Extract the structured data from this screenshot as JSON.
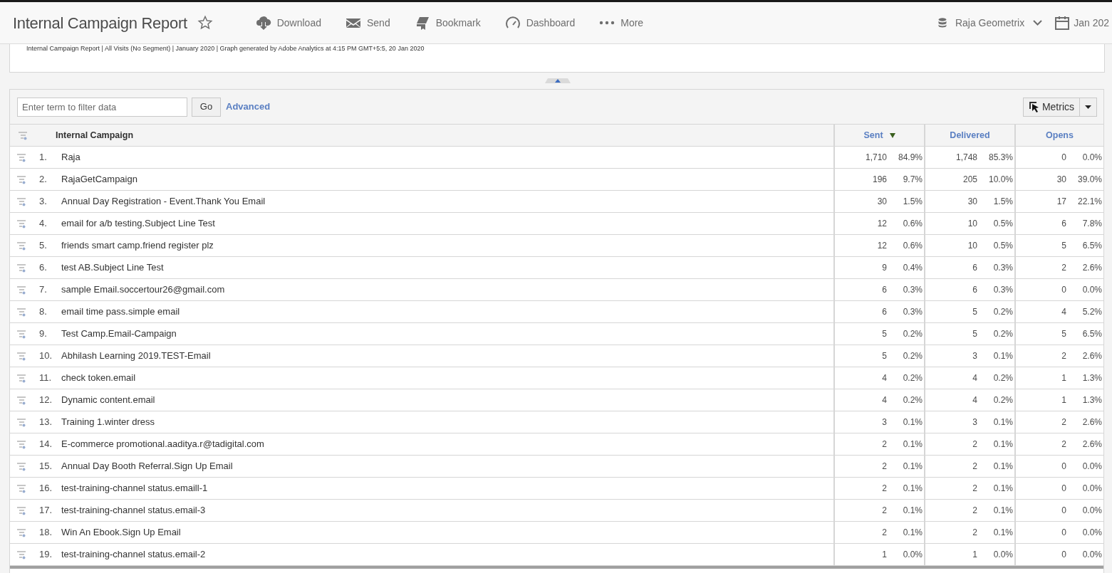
{
  "header": {
    "title": "Internal Campaign Report",
    "actions": [
      {
        "kind": "download",
        "label": "Download"
      },
      {
        "kind": "send",
        "label": "Send"
      },
      {
        "kind": "bookmark",
        "label": "Bookmark"
      },
      {
        "kind": "dashboard",
        "label": "Dashboard"
      },
      {
        "kind": "more",
        "label": "More"
      }
    ],
    "suite": "Raja Geometrix",
    "date": "Jan 202"
  },
  "caption": "Internal Campaign Report | All Visits (No Segment) | January 2020 | Graph generated by Adobe Analytics at 4:15 PM GMT+5:5, 20 Jan 2020",
  "filter": {
    "placeholder": "Enter term to filter data",
    "go": "Go",
    "advanced": "Advanced",
    "metrics": "Metrics"
  },
  "table": {
    "dimension": "Internal Campaign",
    "columns": [
      {
        "label": "Sent",
        "sorted": true
      },
      {
        "label": "Delivered",
        "sorted": false
      },
      {
        "label": "Opens",
        "sorted": false
      }
    ],
    "rows": [
      {
        "rank": "1.",
        "name": "Raja",
        "values": [
          [
            "1,710",
            "84.9%"
          ],
          [
            "1,748",
            "85.3%"
          ],
          [
            "0",
            "0.0%"
          ]
        ]
      },
      {
        "rank": "2.",
        "name": "RajaGetCampaign",
        "values": [
          [
            "196",
            "9.7%"
          ],
          [
            "205",
            "10.0%"
          ],
          [
            "30",
            "39.0%"
          ]
        ]
      },
      {
        "rank": "3.",
        "name": "Annual Day Registration - Event.Thank You Email",
        "values": [
          [
            "30",
            "1.5%"
          ],
          [
            "30",
            "1.5%"
          ],
          [
            "17",
            "22.1%"
          ]
        ]
      },
      {
        "rank": "4.",
        "name": "email for a/b testing.Subject Line Test",
        "values": [
          [
            "12",
            "0.6%"
          ],
          [
            "10",
            "0.5%"
          ],
          [
            "6",
            "7.8%"
          ]
        ]
      },
      {
        "rank": "5.",
        "name": "friends smart camp.friend register plz",
        "values": [
          [
            "12",
            "0.6%"
          ],
          [
            "10",
            "0.5%"
          ],
          [
            "5",
            "6.5%"
          ]
        ]
      },
      {
        "rank": "6.",
        "name": "test AB.Subject Line Test",
        "values": [
          [
            "9",
            "0.4%"
          ],
          [
            "6",
            "0.3%"
          ],
          [
            "2",
            "2.6%"
          ]
        ]
      },
      {
        "rank": "7.",
        "name": "sample Email.soccertour26@gmail.com",
        "values": [
          [
            "6",
            "0.3%"
          ],
          [
            "6",
            "0.3%"
          ],
          [
            "0",
            "0.0%"
          ]
        ]
      },
      {
        "rank": "8.",
        "name": "email time pass.simple email",
        "values": [
          [
            "6",
            "0.3%"
          ],
          [
            "5",
            "0.2%"
          ],
          [
            "4",
            "5.2%"
          ]
        ]
      },
      {
        "rank": "9.",
        "name": "Test Camp.Email-Campaign",
        "values": [
          [
            "5",
            "0.2%"
          ],
          [
            "5",
            "0.2%"
          ],
          [
            "5",
            "6.5%"
          ]
        ]
      },
      {
        "rank": "10.",
        "name": "Abhilash Learning 2019.TEST-Email",
        "values": [
          [
            "5",
            "0.2%"
          ],
          [
            "3",
            "0.1%"
          ],
          [
            "2",
            "2.6%"
          ]
        ]
      },
      {
        "rank": "11.",
        "name": "check token.email",
        "values": [
          [
            "4",
            "0.2%"
          ],
          [
            "4",
            "0.2%"
          ],
          [
            "1",
            "1.3%"
          ]
        ]
      },
      {
        "rank": "12.",
        "name": "Dynamic content.email",
        "values": [
          [
            "4",
            "0.2%"
          ],
          [
            "4",
            "0.2%"
          ],
          [
            "1",
            "1.3%"
          ]
        ]
      },
      {
        "rank": "13.",
        "name": "Training 1.winter dress",
        "values": [
          [
            "3",
            "0.1%"
          ],
          [
            "3",
            "0.1%"
          ],
          [
            "2",
            "2.6%"
          ]
        ]
      },
      {
        "rank": "14.",
        "name": "E-commerce promotional.aaditya.r@tadigital.com",
        "values": [
          [
            "2",
            "0.1%"
          ],
          [
            "2",
            "0.1%"
          ],
          [
            "2",
            "2.6%"
          ]
        ]
      },
      {
        "rank": "15.",
        "name": "Annual Day Booth Referral.Sign Up Email",
        "values": [
          [
            "2",
            "0.1%"
          ],
          [
            "2",
            "0.1%"
          ],
          [
            "0",
            "0.0%"
          ]
        ]
      },
      {
        "rank": "16.",
        "name": "test-training-channel status.emaill-1",
        "values": [
          [
            "2",
            "0.1%"
          ],
          [
            "2",
            "0.1%"
          ],
          [
            "0",
            "0.0%"
          ]
        ]
      },
      {
        "rank": "17.",
        "name": "test-training-channel status.email-3",
        "values": [
          [
            "2",
            "0.1%"
          ],
          [
            "2",
            "0.1%"
          ],
          [
            "0",
            "0.0%"
          ]
        ]
      },
      {
        "rank": "18.",
        "name": "Win An Ebook.Sign Up Email",
        "values": [
          [
            "2",
            "0.1%"
          ],
          [
            "2",
            "0.1%"
          ],
          [
            "0",
            "0.0%"
          ]
        ]
      },
      {
        "rank": "19.",
        "name": "test-training-channel status.email-2",
        "values": [
          [
            "1",
            "0.0%"
          ],
          [
            "1",
            "0.0%"
          ],
          [
            "0",
            "0.0%"
          ]
        ]
      }
    ]
  }
}
